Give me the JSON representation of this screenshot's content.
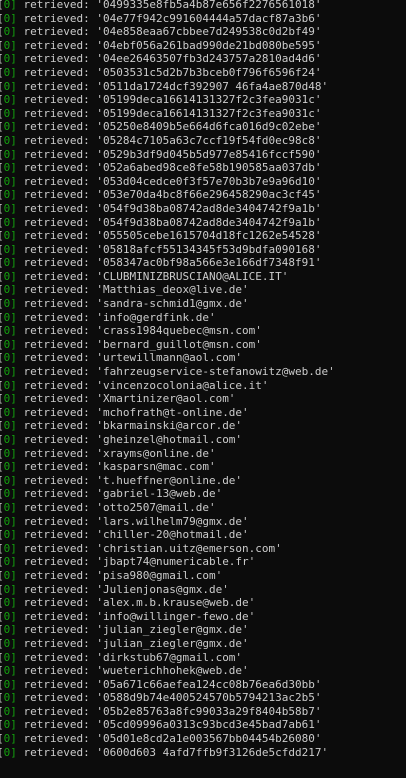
{
  "terminal": {
    "prefix_open": "[",
    "status_mark": "0",
    "prefix_close": "]",
    "label": " retrieved: ",
    "lines": [
      "'0499335e8fb5a4b87e656f2276561018'",
      "'04e77f942c991604444a57dacf87a3b6'",
      "'04e858eaa67cbbee7d249538c0d2bf49'",
      "'04ebf056a261bad990de21bd080be595'",
      "'04ee26463507fb3d243757a2810ad4d6'",
      "'0503531c5d2b7b3bceb0f796f6596f24'",
      "'0511da1724dcf392907 46fa4ae870d48'",
      "'05199deca16614131327f2c3fea9031c'",
      "'05199deca16614131327f2c3fea9031c'",
      "'05250e8409b5e664d6fca016d9c02ebe'",
      "'05284c7105a63c7ccf19f54fd0ec98c8'",
      "'0529b3df9d045b5d977e85416fccf590'",
      "'052a6abed98ce8fe58b190585aa037db'",
      "'053d04cedce0f3f57e70b3b7e9a96d10'",
      "'053e70da4bc8f66e296458290ac3cf45'",
      "'054f9d38ba08742ad8de3404742f9a1b'",
      "'054f9d38ba08742ad8de3404742f9a1b'",
      "'055505cebe1615704d18fc1262e54528'",
      "'05818afcf55134345f53d9bdfa090168'",
      "'058347ac0bf98a566e3e166df7348f91'",
      "'CLUBMINIZBRUSCIANO@ALICE.IT'",
      "'Matthias_deox@live.de'",
      "'sandra-schmid1@gmx.de'",
      "'info@gerdfink.de'",
      "'crass1984quebec@msn.com'",
      "'bernard_guillot@msn.com'",
      "'urtewillmann@aol.com'",
      "'fahrzeugservice-stefanowitz@web.de'",
      "'vincenzocolonia@alice.it'",
      "'Xmartinizer@aol.com'",
      "'mchofrath@t-online.de'",
      "'bkarmainski@arcor.de'",
      "'gheinzel@hotmail.com'",
      "'xrayms@online.de'",
      "'kasparsn@mac.com'",
      "'t.hueffner@online.de'",
      "'gabriel-13@web.de'",
      "'otto2507@mail.de'",
      "'lars.wilhelm79@gmx.de'",
      "'chiller-20@hotmail.de'",
      "'christian.uitz@emerson.com'",
      "'jbapt74@numericable.fr'",
      "'pisa980@gmail.com'",
      "'Julienjonas@gmx.de'",
      "'alex.m.b.krause@web.de'",
      "'info@willinger-fewo.de'",
      "'julian_ziegler@gmx.de'",
      "'julian_ziegler@gmx.de'",
      "'dirkstub67@gmail.com'",
      "'wueterichhohek@web.de'",
      "'05a671c66aefea124cc08b76ea6d30bb'",
      "'0588d9b74e400524570b5794213ac2b5'",
      "'05b2e85763a8fc99033a29f8404b58b7'",
      "'05cd09996a0313c93bcd3e45bad7ab61'",
      "'05d01e8cd2a1e003567bb04454b26080'",
      "'0600d603 4afd7ffb9f3126de5cfdd217'"
    ]
  },
  "colors": {
    "background": "#0c0c0c",
    "text": "#cccccc",
    "status_mark": "#13a10e"
  }
}
